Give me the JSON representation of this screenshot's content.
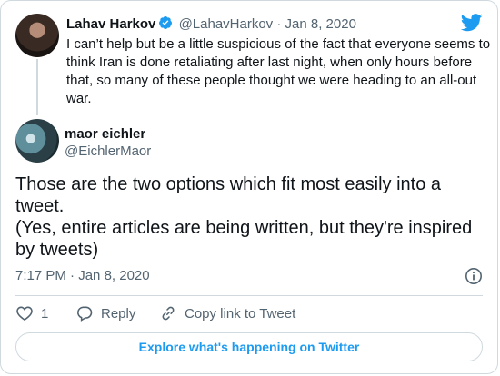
{
  "quoted_tweet": {
    "name": "Lahav Harkov",
    "handle": "@LahavHarkov",
    "separator": "·",
    "date": "Jan 8, 2020",
    "text": "I can’t help but be a little suspicious of the fact that everyone seems to think Iran is done retaliating after last night, when only hours before that, so many of these people thought we were heading to an all-out war."
  },
  "tweet": {
    "name": "maor eichler",
    "handle": "@EichlerMaor",
    "text_line1": "Those are the two options which fit most easily into a tweet.",
    "text_line2": "(Yes, entire articles are being written, but they're inspired by tweets)",
    "time": "7:17 PM",
    "separator": "·",
    "date": "Jan 8, 2020"
  },
  "actions": {
    "like_count": "1",
    "reply_label": "Reply",
    "copy_label": "Copy link to Tweet"
  },
  "explore_label": "Explore what's happening on Twitter",
  "icons": {
    "verified": "verified-badge-icon",
    "twitter": "twitter-bird-icon",
    "info": "info-icon",
    "like": "heart-icon",
    "reply": "reply-bubble-icon",
    "copy": "link-icon"
  },
  "colors": {
    "accent": "#1d9bf0",
    "text": "#0f1419",
    "muted": "#536471",
    "border": "#cfd9de"
  }
}
